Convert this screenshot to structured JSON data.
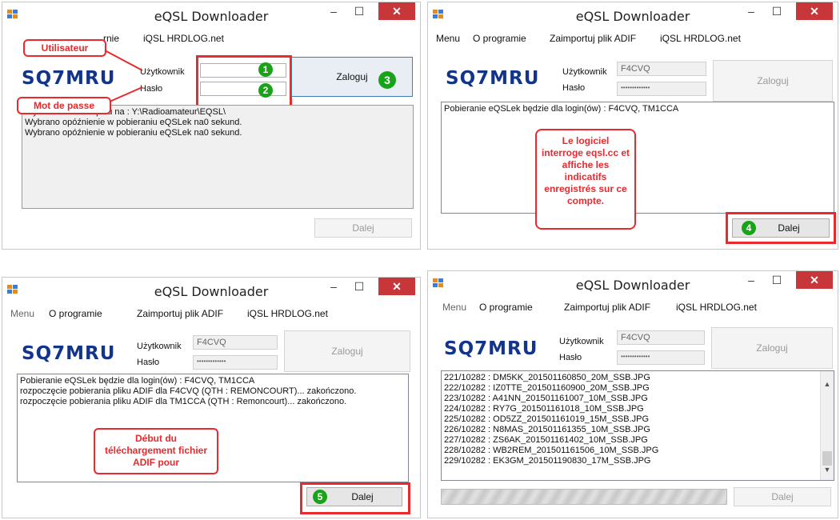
{
  "common": {
    "title": "eQSL Downloader",
    "logo": "SQ7MRU",
    "user_label": "Użytkownik",
    "pass_label": "Hasło",
    "login_button": "Zaloguj",
    "next_button": "Dalej",
    "menu": [
      "Menu",
      "O programie",
      "Zaimportuj plik ADIF",
      "iQSL HRDLOG.net"
    ],
    "username_value": "F4CVQ",
    "password_mask": "•••••••••••••",
    "win_min": "–",
    "win_max": "☐",
    "win_close": "✕",
    "colors": {
      "accent_red": "#e8292e",
      "step_green": "#19a319",
      "logo_blue": "#12348a"
    }
  },
  "panel1": {
    "menu_partial": "rnie",
    "menu_item": "iQSL HRDLOG.net",
    "log": [
      "Wybrano folder zapisu na : Y:\\Radioamateur\\EQSL\\",
      "Wybrano opóźnienie w pobieraniu eQSLek na0 sekund.",
      "Wybrano opóźnienie w pobieraniu eQSLek na0 sekund."
    ],
    "callout_user": "Utilisateur",
    "callout_pass": "Mot de passe",
    "steps": [
      "1",
      "2",
      "3"
    ]
  },
  "panel2": {
    "log": [
      "Pobieranie eQSLek będzie dla login(ów) : F4CVQ, TM1CCA"
    ],
    "callout": "Le logiciel interroge eqsl.cc et affiche les indicatifs enregistrés sur ce compte.",
    "step": "4"
  },
  "panel3": {
    "log": [
      "Pobieranie eQSLek będzie dla login(ów) : F4CVQ, TM1CCA",
      "rozpoczęcie pobierania pliku ADIF dla F4CVQ (QTH : REMONCOURT)... zakończono.",
      "rozpoczęcie pobierania pliku ADIF dla TM1CCA (QTH : Remoncourt)... zakończono."
    ],
    "callout": "Début du téléchargement fichier ADIF pour",
    "step": "5"
  },
  "panel4": {
    "log": [
      "221/10282 : DM5KK_201501160850_20M_SSB.JPG",
      "222/10282 : IZ0TTE_201501160900_20M_SSB.JPG",
      "223/10282 : A41NN_201501161007_10M_SSB.JPG",
      "224/10282 : RY7G_201501161018_10M_SSB.JPG",
      "225/10282 : OD5ZZ_201501161019_15M_SSB.JPG",
      "226/10282 : N8MAS_201501161355_10M_SSB.JPG",
      "227/10282 : ZS6AK_201501161402_10M_SSB.JPG",
      "228/10282 : WB2REM_201501161506_10M_SSB.JPG",
      "229/10282 : EK3GM_201501190830_17M_SSB.JPG"
    ],
    "scroll_up": "▲",
    "scroll_down": "▼"
  }
}
